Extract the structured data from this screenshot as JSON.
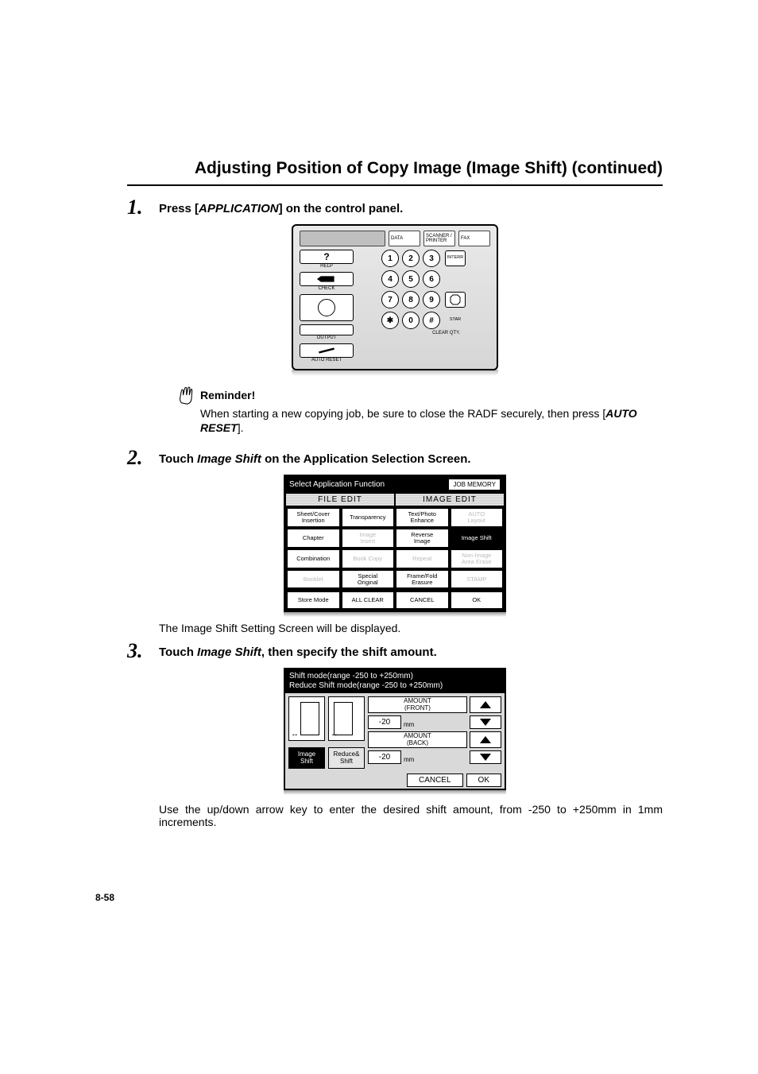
{
  "title": "Adjusting Position of Copy Image (Image Shift) (continued)",
  "page_number": "8-58",
  "steps": {
    "s1": {
      "num": "1.",
      "pre": "Press [",
      "app": "APPLICATION",
      "post": "] on the control panel."
    },
    "s2": {
      "num": "2.",
      "pre": "Touch ",
      "app": "Image Shift",
      "post": " on the Application Selection Screen."
    },
    "s3": {
      "num": "3.",
      "pre": "Touch ",
      "app": "Image Shift",
      "post": ", then specify the shift amount."
    }
  },
  "reminder": {
    "label": "Reminder!",
    "body_pre": "When starting a new copying job, be sure to close the RADF securely, then press [",
    "auto_reset": "AUTO RESET",
    "body_post": "]."
  },
  "after_step2": "The Image Shift Setting Screen will be displayed.",
  "after_step3": "Use the up/down arrow key to enter the desired shift amount, from -250 to +250mm in 1mm increments.",
  "panel": {
    "data": "DATA",
    "scanner": "SCANNER / PRINTER",
    "fax": "FAX",
    "help": "HELP",
    "check": "CHECK",
    "output": "OUTPUT",
    "auto_reset": "AUTO RESET",
    "interr": "INTERR",
    "star_mark": "STAR",
    "clear_qty": "CLEAR QTY.",
    "keys": {
      "k1": "1",
      "k2": "2",
      "k3": "3",
      "k4": "4",
      "k5": "5",
      "k6": "6",
      "k7": "7",
      "k8": "8",
      "k9": "9",
      "k0": "0",
      "kast": "✱",
      "khash": "#"
    }
  },
  "fig2": {
    "title": "Select Application Function",
    "job_memory": "JOB MEMORY",
    "tab_file": "FILE EDIT",
    "tab_image": "IMAGE EDIT",
    "cells": {
      "c0": "Sheet/Cover\nInsertion",
      "c1": "Transparency",
      "c2": "Text/Photo\nEnhance",
      "c3": "AUTO\nLayout",
      "c4": "Chapter",
      "c5": "Image\nInsert",
      "c6": "Reverse\nImage",
      "c7": "Image Shift",
      "c8": "Combination",
      "c9": "Book Copy",
      "c10": "Repeat",
      "c11": "Non-Image\nArea Erase",
      "c12": "Booklet",
      "c13": "Special\nOriginal",
      "c14": "Frame/Fold\nErasure",
      "c15": "STAMP"
    },
    "footer": {
      "store": "Store Mode",
      "clear": "ALL CLEAR",
      "cancel": "CANCEL",
      "ok": "OK"
    }
  },
  "fig3": {
    "head1": "Shift mode(range -250 to +250mm)",
    "head2": "Reduce Shift mode(range -250 to +250mm)",
    "amount_front": "AMOUNT\n(FRONT)",
    "amount_back": "AMOUNT\n(BACK)",
    "val_front": "-20",
    "val_back": "-20",
    "mm": "mm",
    "mode_image_shift": "Image\nShift",
    "mode_reduce_shift": "Reduce&\nShift",
    "cancel": "CANCEL",
    "ok": "OK"
  }
}
